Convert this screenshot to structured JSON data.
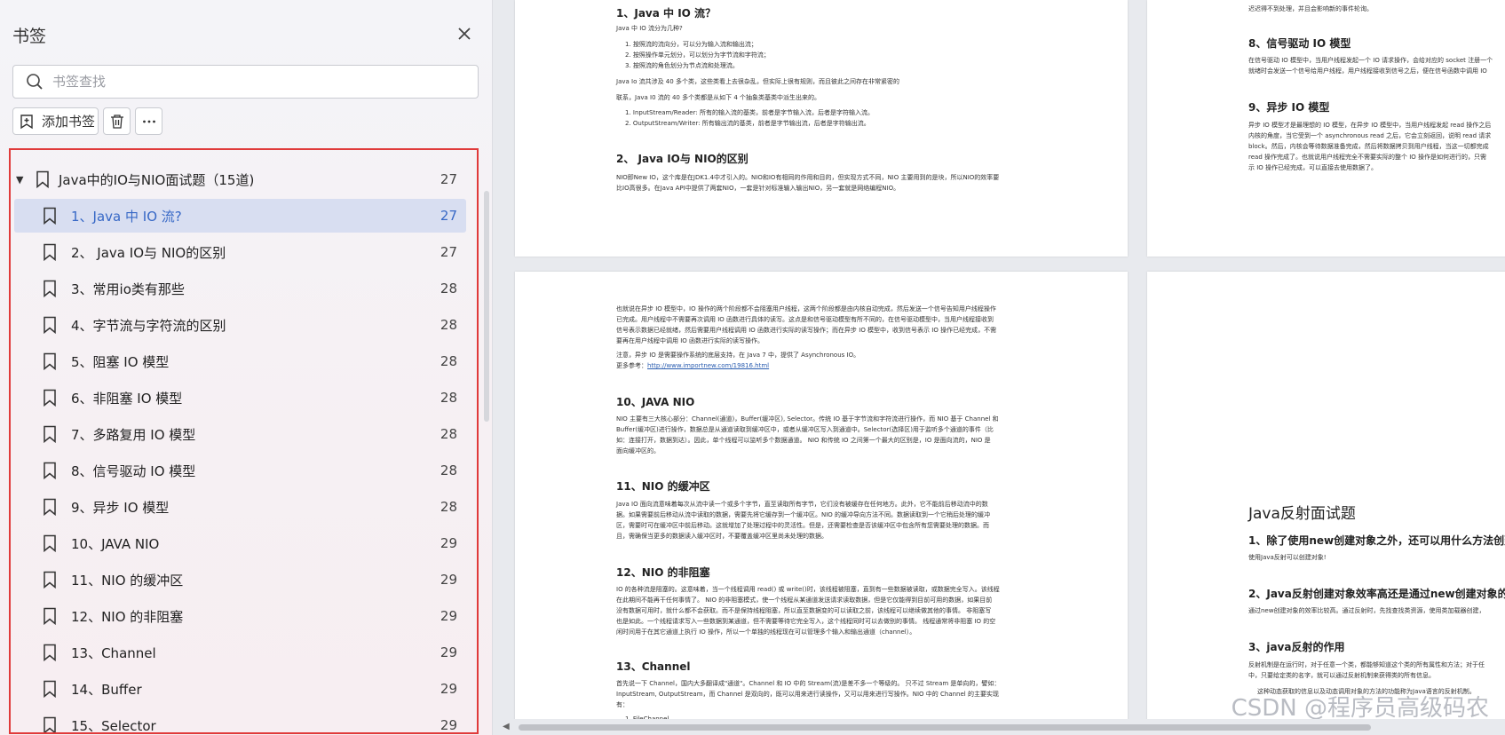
{
  "sidebar": {
    "title": "书签",
    "search_placeholder": "书签查找",
    "add_label": "添加书签",
    "items": [
      {
        "label": "Java中的IO与NIO面试题（15道)",
        "page": "27"
      },
      {
        "label": "1、Java 中 IO 流?",
        "page": "27"
      },
      {
        "label": "2、 Java IO与 NIO的区别",
        "page": "27"
      },
      {
        "label": "3、常用io类有那些",
        "page": "28"
      },
      {
        "label": "4、字节流与字符流的区别",
        "page": "28"
      },
      {
        "label": "5、阻塞 IO 模型",
        "page": "28"
      },
      {
        "label": "6、非阻塞 IO 模型",
        "page": "28"
      },
      {
        "label": "7、多路复用 IO 模型",
        "page": "28"
      },
      {
        "label": "8、信号驱动 IO 模型",
        "page": "28"
      },
      {
        "label": "9、异步 IO 模型",
        "page": "28"
      },
      {
        "label": "10、JAVA NIO",
        "page": "29"
      },
      {
        "label": "11、NIO 的缓冲区",
        "page": "29"
      },
      {
        "label": "12、NIO 的非阻塞",
        "page": "29"
      },
      {
        "label": "13、Channel",
        "page": "29"
      },
      {
        "label": "14、Buffer",
        "page": "29"
      },
      {
        "label": "15、Selector",
        "page": "29"
      }
    ]
  },
  "doc": {
    "p1": {
      "h1": "1、Java 中 IO 流？",
      "l1": "Java 中 IO 流分为几种?",
      "l2": "1. 按照流的流向分，可以分为输入流和输出流；",
      "l3": "2. 按照操作单元划分，可以划分为字节流和字符流；",
      "l4": "3. 按照流的角色划分为节点流和处理流。",
      "l5": "Java Io 流共涉及 40 多个类，这些类看上去很杂乱，但实际上很有规则，而且彼此之间存在非常紧密的",
      "l6": "联系，Java I0 流的 40 多个类都是从如下 4 个抽象类基类中派生出来的。",
      "l7": "1. InputStream/Reader: 所有的输入流的基类，前者是字节输入流，后者是字符输入流。",
      "l8": "2. OutputStream/Writer: 所有输出流的基类，前者是字节输出流，后者是字符输出流。",
      "h2": "2、 Java IO与 NIO的区别",
      "l9": "NIO即New IO，这个库是在JDK1.4中才引入的。NIO和IO有相同的作用和目的，但实现方式不同，NIO 主要用到的是块，所以NIO的效率要",
      "l10": "比IO高很多。在Java API中提供了两套NIO，一套是针对标准输入输出NIO，另一套就是网络编程NIO。"
    },
    "p2": {
      "l0": "迟迟得不到处理，并且会影响新的事件轮询。",
      "h1": "8、信号驱动 IO 模型",
      "l1": "在信号驱动 IO 模型中，当用户线程发起一个 IO 请求操作，会给对应的 socket 注册一个",
      "l2": "就绪时会发送一个信号给用户线程，用户线程接收到信号之后，便在信号函数中调用 IO",
      "h2": "9、异步 IO 模型",
      "l3": "异步 IO 模型才是最理想的 IO 模型，在异步 IO 模型中，当用户线程发起 read 操作之后",
      "l4": "内核的角度，当它受到一个 asynchronous read 之后，它会立刻返回，说明 read 请求",
      "l5": "block。然后，内核会等待数据准备完成，然后将数据拷贝到用户线程，当这一切都完成",
      "l6": "read 操作完成了。也就说用户线程完全不需要实际的整个 IO 操作是如何进行的，只需",
      "l7": "示 IO 操作已经完成，可以直接去使用数据了。"
    },
    "p3": {
      "l1": "也就说在异步 IO 模型中，IO 操作的两个阶段都不会阻塞用户线程，这两个阶段都是由内核自动完成，然后发送一个信号告知用户线程操作",
      "l2": "已完成。用户线程中不需要再次调用 IO 函数进行具体的读写。这点是和信号驱动模型有所不同的，在信号驱动模型中，当用户线程接收到",
      "l3": "信号表示数据已经就绪，然后需要用户线程调用 IO 函数进行实际的读写操作；而在异步 IO 模型中，收到信号表示 IO 操作已经完成，不需",
      "l4": "要再在用户线程中调用 IO 函数进行实际的读写操作。",
      "l5": "注意，异步 IO 是需要操作系统的底层支持，在 Java 7 中，提供了 Asynchronous IO。",
      "l6a": "更多参考：",
      "l6b": "http://www.importnew.com/19816.html",
      "h1": "10、JAVA NIO",
      "l7": "NIO 主要有三大核心部分：Channel(通道)，Buffer(缓冲区), Selector。传统 IO 基于字节流和字符流进行操作，而 NIO 基于 Channel 和",
      "l8": "Buffer(缓冲区)进行操作，数据总是从通道读取到缓冲区中，或者从缓冲区写入到通道中。Selector(选择区)用于监听多个通道的事件（比",
      "l9": "如：连接打开，数据到达）。因此，单个线程可以监听多个数据通道。 NIO 和传统 IO 之间第一个最大的区别是，IO 是面向流的，NIO 是",
      "l10": "面向缓冲区的。",
      "h2": "11、NIO 的缓冲区",
      "l11": "Java IO 面向流意味着每次从流中读一个或多个字节，直至读取所有字节，它们没有被缓存在任何地方。此外，它不能前后移动流中的数",
      "l12": "据。如果需要前后移动从流中读取的数据，需要先将它缓存到一个缓冲区。NIO 的缓冲导向方法不同。数据读取到一个它稍后处理的缓冲",
      "l13": "区，需要时可在缓冲区中前后移动。这就增加了处理过程中的灵活性。但是，还需要检查是否该缓冲区中包含所有您需要处理的数据。而",
      "l14": "且，需确保当更多的数据读入缓冲区时，不要覆盖缓冲区里尚未处理的数据。",
      "h3": "12、NIO 的非阻塞",
      "l15": "IO 的各种流是阻塞的。这意味着，当一个线程调用 read() 或 write()时，该线程被阻塞，直到有一些数据被读取，或数据完全写入。该线程",
      "l16": "在此期间不能再干任何事情了。 NIO 的非阻塞模式，使一个线程从某通道发送请求读取数据，但是它仅能得到目前可用的数据，如果目前",
      "l17": "没有数据可用时，就什么都不会获取。而不是保持线程阻塞，所以直至数据变的可以读取之前，该线程可以继续做其他的事情。 非阻塞写",
      "l18": "也是如此。一个线程请求写入一些数据到某通道，但不需要等待它完全写入，这个线程同时可以去做别的事情。 线程通常将非阻塞 IO 的空",
      "l19": "闲时间用于在其它通道上执行 IO 操作，所以一个单独的线程现在可以管理多个输入和输出通道（channel）。",
      "h4": "13、Channel",
      "l20": "首先说一下 Channel，国内大多翻译成\"通道\"。Channel 和 IO 中的 Stream(流)是差不多一个等级的。 只不过 Stream 是单向的，譬如：",
      "l21": "InputStream, OutputStream，而 Channel 是双向的，既可以用来进行读操作，又可以用来进行写操作。NIO 中的 Channel 的主要实现",
      "l22": "有：",
      "l23": "1. FileChannel"
    },
    "p4": {
      "title": "Java反射面试题",
      "h1": "1、除了使用new创建对象之外，还可以用什么方法创建对",
      "l1": "使用Java反射可以创建对象!",
      "h2": "2、Java反射创建对象效率高还是通过new创建对象的效率",
      "l2": "通过new创建对象的效率比较高。通过反射时，先找查找类资源，使用类加载器创建，",
      "h3": "3、java反射的作用",
      "l3": "反射机制是在运行时，对于任意一个类，都能够知道这个类的所有属性和方法；对于任",
      "l4": "中，只要给定类的名字，就可以通过反射机制来获得类的所有信息。",
      "l5": "这种动态获取的信息以及动态调用对象的方法的功能称为Java语言的反射机制。"
    }
  },
  "watermark": "CSDN @程序员高级码农",
  "colors": {
    "accent": "#3768c6",
    "highlight_border": "#e03a3a",
    "selected_bg": "#d8def1"
  }
}
